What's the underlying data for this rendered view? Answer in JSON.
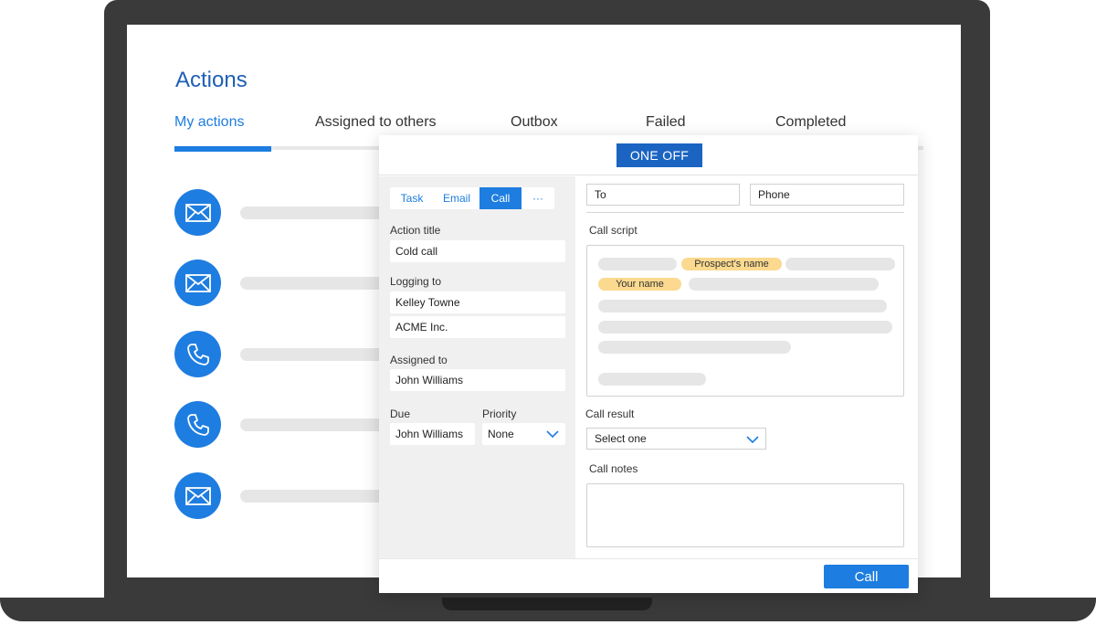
{
  "page": {
    "title": "Actions",
    "tabs": [
      "My actions",
      "Assigned to others",
      "Outbox",
      "Failed",
      "Completed"
    ]
  },
  "action_list": {
    "items": [
      {
        "icon": "envelope-icon"
      },
      {
        "icon": "envelope-icon"
      },
      {
        "icon": "phone-icon"
      },
      {
        "icon": "phone-icon"
      },
      {
        "icon": "envelope-icon"
      }
    ]
  },
  "modal": {
    "header_button": "ONE OFF",
    "type_tabs": [
      "Task",
      "Email",
      "Call",
      "···"
    ],
    "active_type": "Call",
    "action_title": {
      "label": "Action title",
      "value": "Cold call"
    },
    "logging_to": {
      "label": "Logging to",
      "contact": "Kelley Towne",
      "company": "ACME Inc."
    },
    "assigned_to": {
      "label": "Assigned to",
      "value": "John Williams"
    },
    "due": {
      "label": "Due",
      "value": "John Williams"
    },
    "priority": {
      "label": "Priority",
      "value": "None"
    },
    "to": {
      "placeholder": "To"
    },
    "phone": {
      "placeholder": "Phone"
    },
    "call_script": {
      "label": "Call script",
      "chips": [
        "Prospect's name",
        "Your name"
      ]
    },
    "call_result": {
      "label": "Call result",
      "value": "Select one"
    },
    "call_notes": {
      "label": "Call notes"
    },
    "submit_button": "Call"
  },
  "colors": {
    "accent": "#1e7de0",
    "header_button": "#1b64c2",
    "chip": "#fbd98f",
    "title": "#1f5fb4"
  }
}
